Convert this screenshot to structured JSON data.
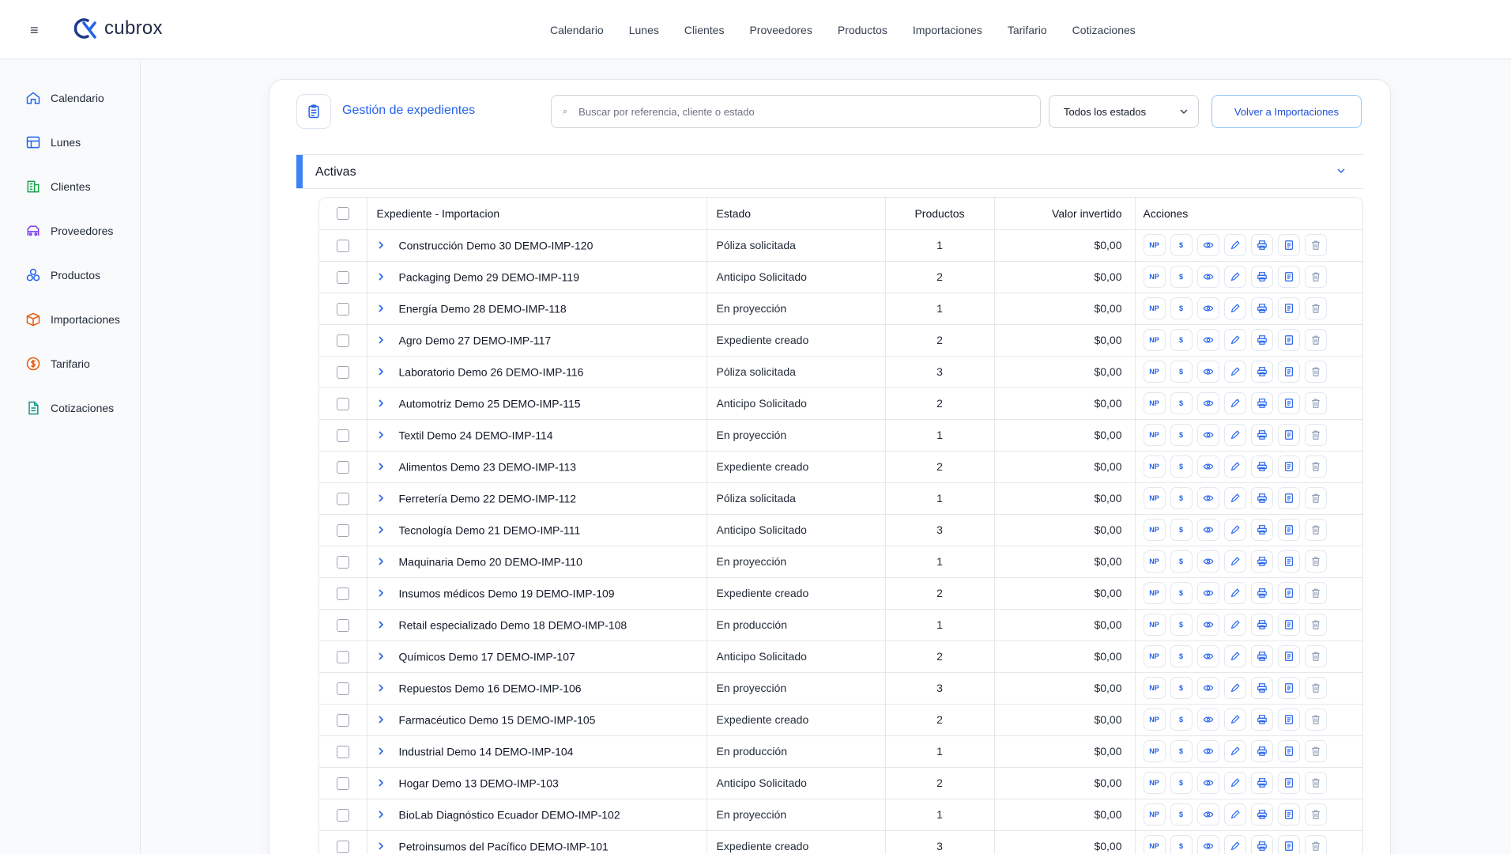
{
  "app": {
    "name": "cubrox"
  },
  "topnav": [
    "Calendario",
    "Lunes",
    "Clientes",
    "Proveedores",
    "Productos",
    "Importaciones",
    "Tarifario",
    "Cotizaciones"
  ],
  "sidebar": [
    {
      "label": "Calendario",
      "icon": "home-icon",
      "color": "#2563eb"
    },
    {
      "label": "Lunes",
      "icon": "grid-icon",
      "color": "#2563eb"
    },
    {
      "label": "Clientes",
      "icon": "building-icon",
      "color": "#16a34a"
    },
    {
      "label": "Proveedores",
      "icon": "truck-icon",
      "color": "#7c3aed"
    },
    {
      "label": "Productos",
      "icon": "boxes-icon",
      "color": "#2563eb"
    },
    {
      "label": "Importaciones",
      "icon": "package-icon",
      "color": "#ea580c"
    },
    {
      "label": "Tarifario",
      "icon": "dollar-circle-icon",
      "color": "#ea580c"
    },
    {
      "label": "Cotizaciones",
      "icon": "document-icon",
      "color": "#0d9488"
    }
  ],
  "header": {
    "title": "Gestión de expedientes",
    "search_placeholder": "Buscar por referencia, cliente o estado",
    "status_filter": "Todos los estados",
    "back_button": "Volver a Importaciones"
  },
  "section": {
    "label": "Activas"
  },
  "table": {
    "columns": [
      "Expediente - Importacion",
      "Estado",
      "Productos",
      "Valor invertido",
      "Acciones"
    ],
    "action_labels": {
      "np": "NP",
      "dollar": "$"
    },
    "rows": [
      {
        "name": "Construcción Demo 30 DEMO-IMP-120",
        "estado": "Póliza solicitada",
        "productos": "1",
        "valor": "$0,00"
      },
      {
        "name": "Packaging Demo 29 DEMO-IMP-119",
        "estado": "Anticipo Solicitado",
        "productos": "2",
        "valor": "$0,00"
      },
      {
        "name": "Energía Demo 28 DEMO-IMP-118",
        "estado": "En proyección",
        "productos": "1",
        "valor": "$0,00"
      },
      {
        "name": "Agro Demo 27 DEMO-IMP-117",
        "estado": "Expediente creado",
        "productos": "2",
        "valor": "$0,00"
      },
      {
        "name": "Laboratorio Demo 26 DEMO-IMP-116",
        "estado": "Póliza solicitada",
        "productos": "3",
        "valor": "$0,00"
      },
      {
        "name": "Automotriz Demo 25 DEMO-IMP-115",
        "estado": "Anticipo Solicitado",
        "productos": "2",
        "valor": "$0,00"
      },
      {
        "name": "Textil Demo 24 DEMO-IMP-114",
        "estado": "En proyección",
        "productos": "1",
        "valor": "$0,00"
      },
      {
        "name": "Alimentos Demo 23 DEMO-IMP-113",
        "estado": "Expediente creado",
        "productos": "2",
        "valor": "$0,00"
      },
      {
        "name": "Ferretería Demo 22 DEMO-IMP-112",
        "estado": "Póliza solicitada",
        "productos": "1",
        "valor": "$0,00"
      },
      {
        "name": "Tecnología Demo 21 DEMO-IMP-111",
        "estado": "Anticipo Solicitado",
        "productos": "3",
        "valor": "$0,00"
      },
      {
        "name": "Maquinaria Demo 20 DEMO-IMP-110",
        "estado": "En proyección",
        "productos": "1",
        "valor": "$0,00"
      },
      {
        "name": "Insumos médicos Demo 19 DEMO-IMP-109",
        "estado": "Expediente creado",
        "productos": "2",
        "valor": "$0,00"
      },
      {
        "name": "Retail especializado Demo 18 DEMO-IMP-108",
        "estado": "En producción",
        "productos": "1",
        "valor": "$0,00"
      },
      {
        "name": "Químicos Demo 17 DEMO-IMP-107",
        "estado": "Anticipo Solicitado",
        "productos": "2",
        "valor": "$0,00"
      },
      {
        "name": "Repuestos Demo 16 DEMO-IMP-106",
        "estado": "En proyección",
        "productos": "3",
        "valor": "$0,00"
      },
      {
        "name": "Farmacéutico Demo 15 DEMO-IMP-105",
        "estado": "Expediente creado",
        "productos": "2",
        "valor": "$0,00"
      },
      {
        "name": "Industrial Demo 14 DEMO-IMP-104",
        "estado": "En producción",
        "productos": "1",
        "valor": "$0,00"
      },
      {
        "name": "Hogar Demo 13 DEMO-IMP-103",
        "estado": "Anticipo Solicitado",
        "productos": "2",
        "valor": "$0,00"
      },
      {
        "name": "BioLab Diagnóstico Ecuador DEMO-IMP-102",
        "estado": "En proyección",
        "productos": "1",
        "valor": "$0,00"
      },
      {
        "name": "Petroinsumos del Pacífico DEMO-IMP-101",
        "estado": "Expediente creado",
        "productos": "3",
        "valor": "$0,00"
      }
    ]
  },
  "colors": {
    "accent": "#2563eb",
    "section_accent": "#3b82f6"
  }
}
